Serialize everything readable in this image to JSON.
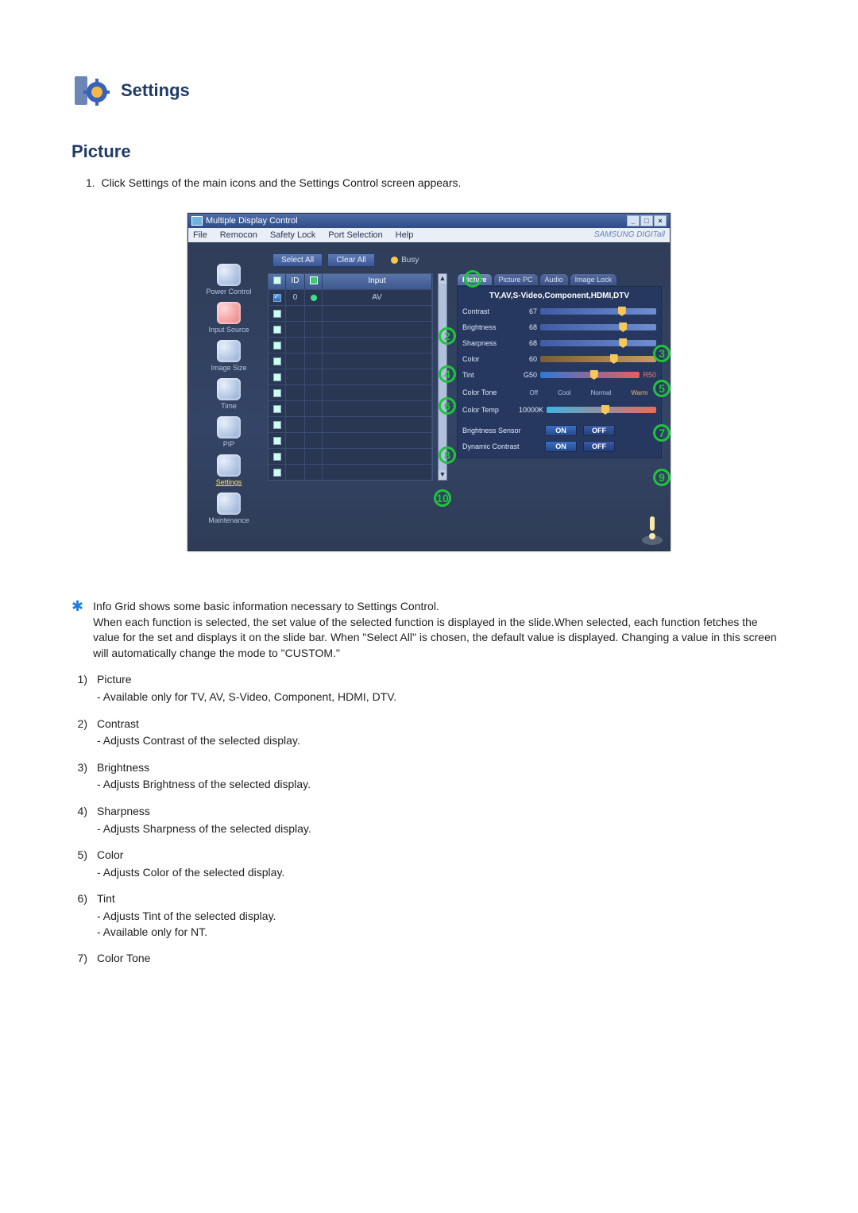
{
  "header": {
    "title": "Settings"
  },
  "section": {
    "title": "Picture"
  },
  "intro": {
    "prefix": "1.",
    "text": "Click Settings of the main icons and the Settings Control screen appears."
  },
  "app": {
    "windowTitle": "Multiple Display Control",
    "menu": [
      "File",
      "Remocon",
      "Safety Lock",
      "Port Selection",
      "Help"
    ],
    "brand": "SAMSUNG DIGITall",
    "toolbar": {
      "selectAll": "Select All",
      "clearAll": "Clear All",
      "busy": "Busy"
    },
    "sidebar": [
      {
        "label": "Power Control",
        "name": "power-control"
      },
      {
        "label": "Input Source",
        "name": "input-source"
      },
      {
        "label": "Image Size",
        "name": "image-size"
      },
      {
        "label": "Time",
        "name": "time"
      },
      {
        "label": "PIP",
        "name": "pip"
      },
      {
        "label": "Settings",
        "name": "settings",
        "active": true
      },
      {
        "label": "Maintenance",
        "name": "maintenance"
      }
    ],
    "grid": {
      "headers": {
        "chk": "",
        "id": "ID",
        "stat": "",
        "input": "Input"
      },
      "rows": [
        {
          "checked": true,
          "id": "0",
          "status": "on",
          "input": "AV"
        },
        {
          "checked": false,
          "id": "",
          "status": "",
          "input": ""
        },
        {
          "checked": false,
          "id": "",
          "status": "",
          "input": ""
        },
        {
          "checked": false,
          "id": "",
          "status": "",
          "input": ""
        },
        {
          "checked": false,
          "id": "",
          "status": "",
          "input": ""
        },
        {
          "checked": false,
          "id": "",
          "status": "",
          "input": ""
        },
        {
          "checked": false,
          "id": "",
          "status": "",
          "input": ""
        },
        {
          "checked": false,
          "id": "",
          "status": "",
          "input": ""
        },
        {
          "checked": false,
          "id": "",
          "status": "",
          "input": ""
        },
        {
          "checked": false,
          "id": "",
          "status": "",
          "input": ""
        },
        {
          "checked": false,
          "id": "",
          "status": "",
          "input": ""
        },
        {
          "checked": false,
          "id": "",
          "status": "",
          "input": ""
        }
      ]
    },
    "tabs": [
      "Picture",
      "Picture PC",
      "Audio",
      "Image Lock"
    ],
    "activeTab": "Picture",
    "subheader": "TV,AV,S-Video,Component,HDMI,DTV",
    "sliders": {
      "contrast": {
        "label": "Contrast",
        "value": "67",
        "pos": 0.67
      },
      "brightness": {
        "label": "Brightness",
        "value": "68",
        "pos": 0.68
      },
      "sharpness": {
        "label": "Sharpness",
        "value": "68",
        "pos": 0.68
      },
      "color": {
        "label": "Color",
        "value": "60",
        "pos": 0.6
      },
      "tint": {
        "label": "Tint",
        "left": "G50",
        "right": "R50",
        "pos": 0.5
      }
    },
    "colorTone": {
      "label": "Color Tone",
      "options": [
        "Off",
        "Cool",
        "Normal",
        "Warm"
      ]
    },
    "colorTemp": {
      "label": "Color Temp",
      "value": "10000K",
      "pos": 0.5
    },
    "brightnessSensor": {
      "label": "Brightness Sensor",
      "on": "ON",
      "off": "OFF"
    },
    "dynamicContrast": {
      "label": "Dynamic Contrast",
      "on": "ON",
      "off": "OFF"
    }
  },
  "annotations": [
    "1",
    "2",
    "3",
    "4",
    "5",
    "6",
    "7",
    "8",
    "9",
    "10"
  ],
  "footer": {
    "starNote": [
      "Info Grid shows some basic information necessary to Settings Control.",
      "When each function is selected, the set value of the selected function is displayed in the slide.When selected, each function fetches the value for the set and displays it on the slide bar. When \"Select All\" is chosen, the default value is displayed. Changing a value in this screen will automatically change the mode to \"CUSTOM.\""
    ],
    "items": [
      {
        "n": "1)",
        "title": "Picture",
        "lines": [
          "Available only for TV, AV, S-Video, Component, HDMI, DTV."
        ]
      },
      {
        "n": "2)",
        "title": "Contrast",
        "lines": [
          "Adjusts Contrast of the selected display."
        ]
      },
      {
        "n": "3)",
        "title": "Brightness",
        "lines": [
          "Adjusts Brightness of the selected display."
        ]
      },
      {
        "n": "4)",
        "title": "Sharpness",
        "lines": [
          "Adjusts Sharpness of the selected display."
        ]
      },
      {
        "n": "5)",
        "title": "Color",
        "lines": [
          "Adjusts Color of the selected display."
        ]
      },
      {
        "n": "6)",
        "title": "Tint",
        "lines": [
          "Adjusts Tint of the selected display.",
          "Available  only for NT."
        ]
      },
      {
        "n": "7)",
        "title": "Color Tone",
        "lines": []
      }
    ]
  }
}
